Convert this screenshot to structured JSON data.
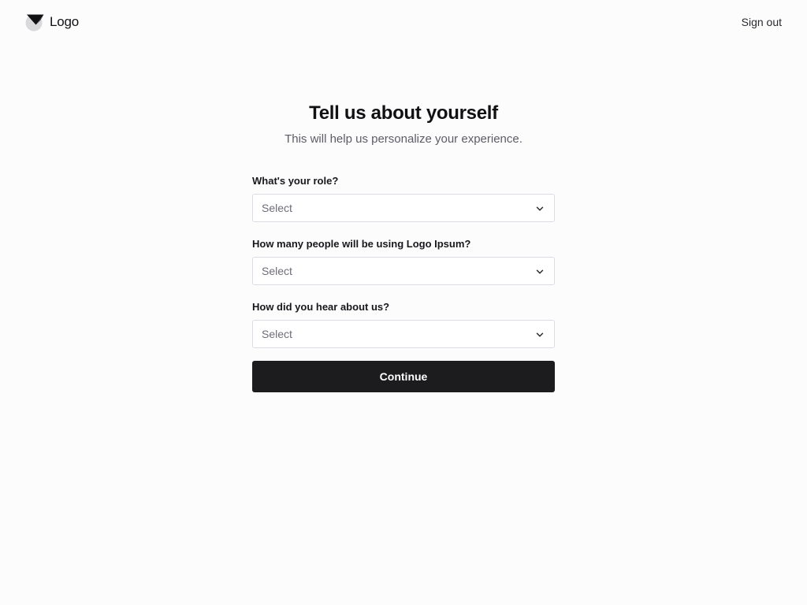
{
  "header": {
    "brand_name": "Logo",
    "brand_icon": "logo-mark-icon",
    "sign_out_label": "Sign out"
  },
  "main": {
    "title": "Tell us about yourself",
    "subtitle": "This will help us personalize your experience.",
    "fields": [
      {
        "label": "What's your role?",
        "value": "Select",
        "icon": "chevron-down-icon"
      },
      {
        "label": "How many people will be using Logo Ipsum?",
        "value": "Select",
        "icon": "chevron-down-icon"
      },
      {
        "label": "How did you hear about us?",
        "value": "Select",
        "icon": "chevron-down-icon"
      }
    ],
    "continue_label": "Continue"
  },
  "colors": {
    "background": "#fcfcfd",
    "primary_button": "#1c1c1f",
    "primary_button_text": "#ffffff",
    "input_border": "#dcdce2",
    "muted_text": "#5c5c66"
  }
}
